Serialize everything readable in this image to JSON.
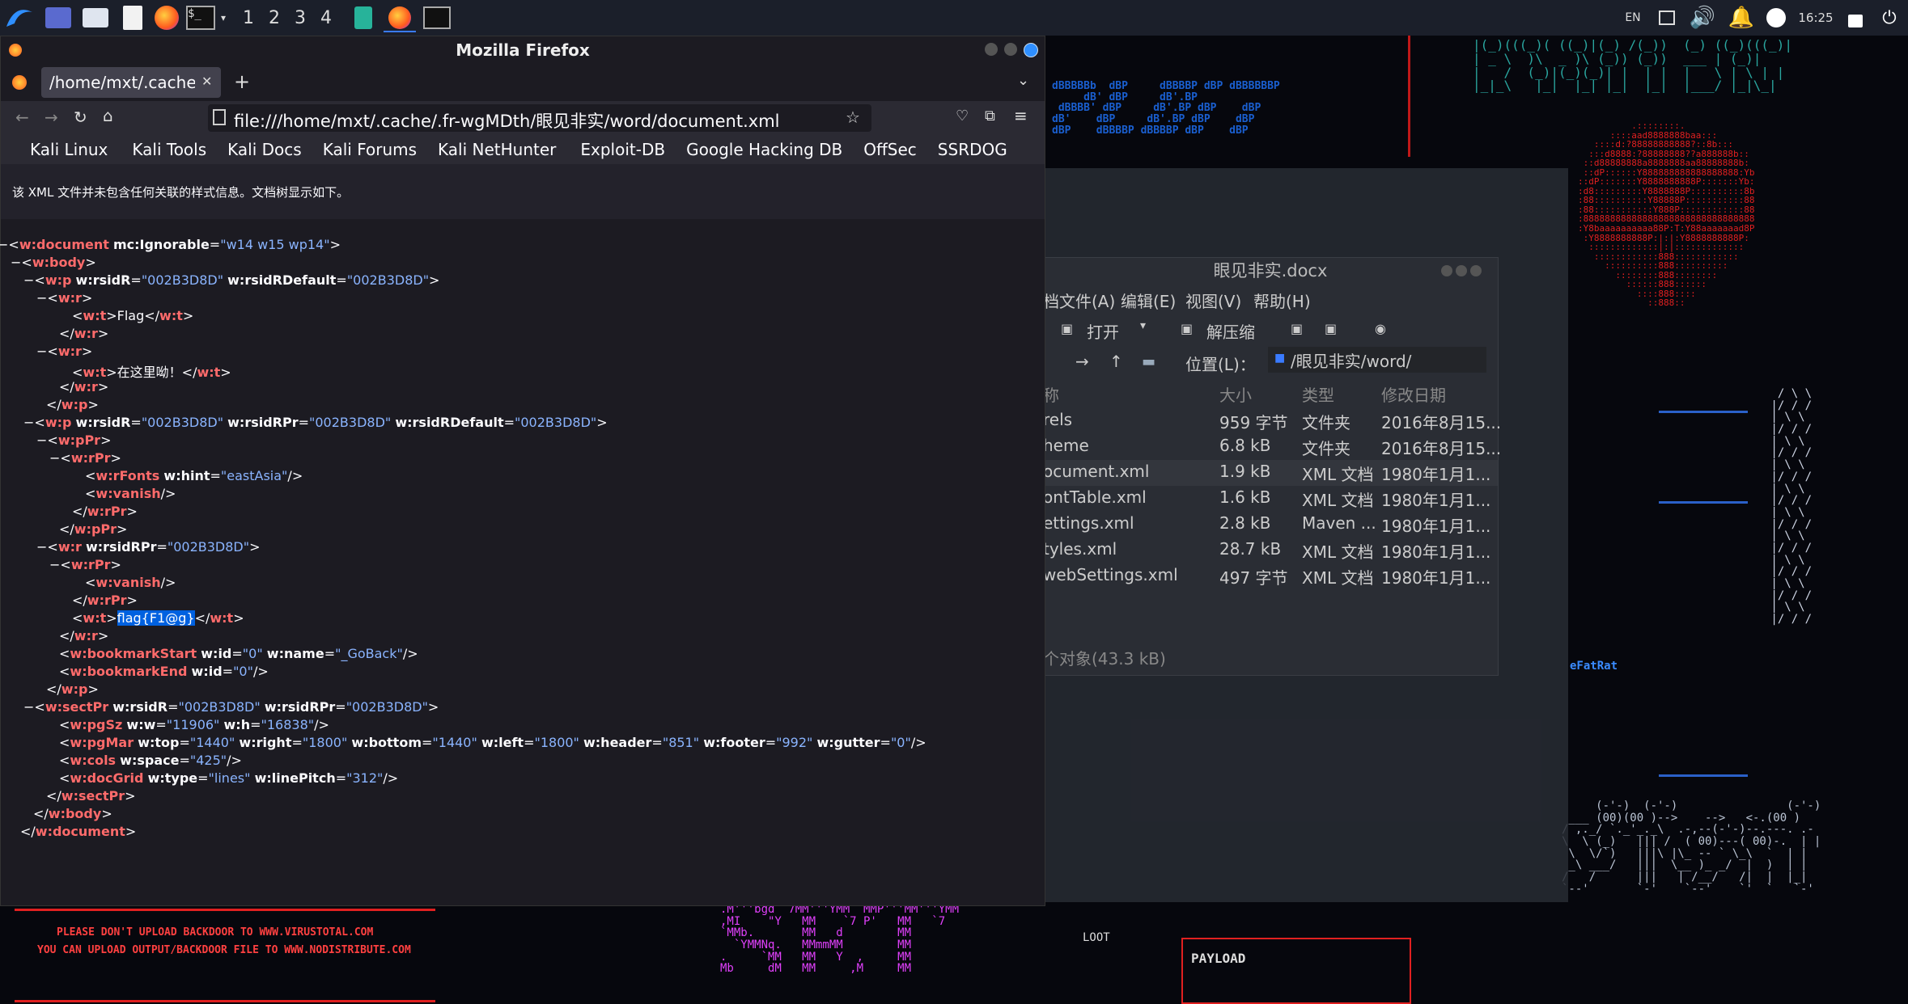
{
  "taskbar": {
    "workspaces": [
      "1",
      "2",
      "3",
      "4"
    ],
    "tray": {
      "lang": "EN",
      "time": "16:25"
    }
  },
  "desktop": {
    "warning_line1": "PLEASE DON'T UPLOAD BACKDOOR TO WWW.VIRUSTOTAL.COM",
    "warning_line2": "YOU CAN UPLOAD OUTPUT/BACKDOOR FILE TO WWW.NODISTRIBUTE.COM",
    "loot": "LOOT",
    "payload": "PAYLOAD",
    "fatrat": "eFatRat"
  },
  "firefox": {
    "window_title": "Mozilla Firefox",
    "tab_title": "/home/mxt/.cache/.",
    "url": "file:///home/mxt/.cache/.fr-wgMDth/眼见非实/word/document.xml",
    "bookmarks": [
      "Kali Linux",
      "Kali Tools",
      "Kali Docs",
      "Kali Forums",
      "Kali NetHunter",
      "Exploit-DB",
      "Google Hacking DB",
      "OffSec",
      "SSRDOG"
    ],
    "info_text": "该 XML 文件并未包含任何关联的样式信息。文档树显示如下。",
    "selected_text": "flag{F1@g}"
  },
  "archive": {
    "title": "眼见非实.docx",
    "menu": [
      "档文件(A)",
      "编辑(E)",
      "视图(V)",
      "帮助(H)"
    ],
    "open_label": "打开",
    "extract_label": "解压缩",
    "location_label": "位置(L)：",
    "location_value": "/眼见非实/word/",
    "columns": [
      "称",
      "大小",
      "类型",
      "修改日期"
    ],
    "rows": [
      {
        "name": "rels",
        "size": "959 字节",
        "type": "文件夹",
        "date": "2016年8月15..."
      },
      {
        "name": "heme",
        "size": "6.8 kB",
        "type": "文件夹",
        "date": "2016年8月15..."
      },
      {
        "name": "ocument.xml",
        "size": "1.9 kB",
        "type": "XML 文档",
        "date": "1980年1月1..."
      },
      {
        "name": "ontTable.xml",
        "size": "1.6 kB",
        "type": "XML 文档",
        "date": "1980年1月1..."
      },
      {
        "name": "ettings.xml",
        "size": "2.8 kB",
        "type": "Maven ...",
        "date": "1980年1月1..."
      },
      {
        "name": "tyles.xml",
        "size": "28.7 kB",
        "type": "XML 文档",
        "date": "1980年1月1..."
      },
      {
        "name": "webSettings.xml",
        "size": "497 字节",
        "type": "XML 文档",
        "date": "1980年1月1..."
      }
    ],
    "status": "个对象(43.3 kB)"
  },
  "colors": {
    "accent": "#0061e0",
    "tag": "#ff6b6b",
    "value": "#8ab4ff"
  }
}
